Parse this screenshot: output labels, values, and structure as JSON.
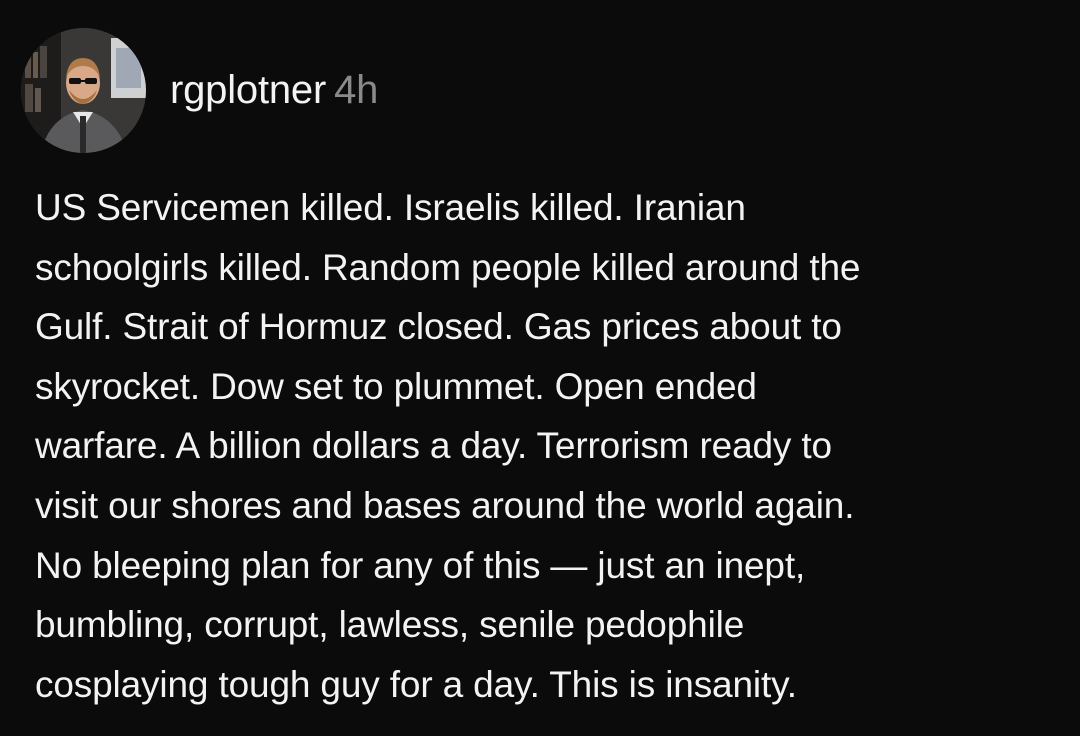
{
  "post": {
    "author": {
      "username": "rgplotner",
      "timestamp": "4h"
    },
    "body_lines": [
      "US Servicemen killed. Israelis killed. Iranian",
      "schoolgirls killed. Random people killed around the",
      "Gulf. Strait of Hormuz closed. Gas prices about to",
      "skyrocket. Dow set to plummet. Open ended",
      "warfare. A billion dollars a day. Terrorism ready to",
      "visit our shores and bases around the world again.",
      "No bleeping plan for any of this — just an inept,",
      "bumbling, corrupt, lawless, senile pedophile",
      "cosplaying tough guy for a day. This is insanity."
    ]
  },
  "colors": {
    "background": "#0b0b0b",
    "text": "#f3f3f3",
    "timestamp": "#8a8a8a"
  }
}
